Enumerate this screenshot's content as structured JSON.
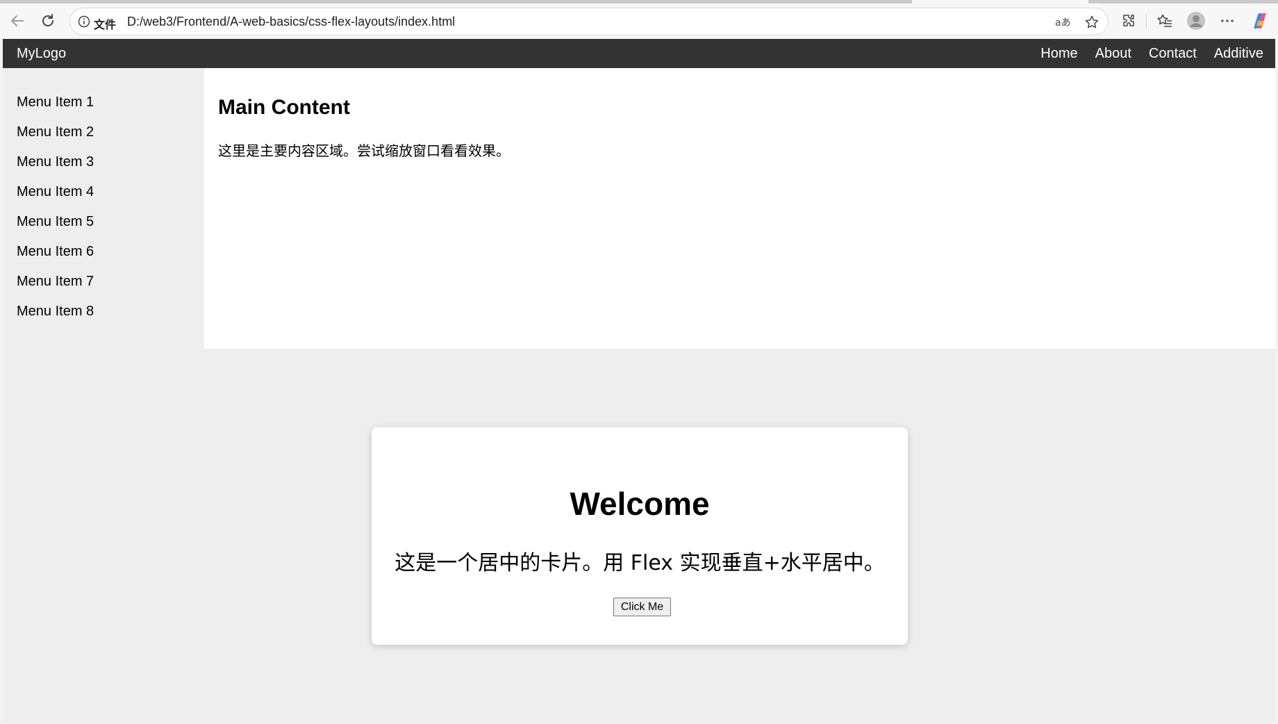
{
  "browser": {
    "address_scheme_label": "文件",
    "url": "D:/web3/Frontend/A-web-basics/css-flex-layouts/index.html"
  },
  "page": {
    "navbar": {
      "logo": "MyLogo",
      "links": [
        "Home",
        "About",
        "Contact",
        "Additive"
      ]
    },
    "sidebar": {
      "items": [
        "Menu Item 1",
        "Menu Item 2",
        "Menu Item 3",
        "Menu Item 4",
        "Menu Item 5",
        "Menu Item 6",
        "Menu Item 7",
        "Menu Item 8"
      ]
    },
    "main": {
      "title": "Main Content",
      "text": "这里是主要内容区域。尝试缩放窗口看看效果。"
    },
    "card": {
      "title": "Welcome",
      "text": "这是一个居中的卡片。用 Flex 实现垂直+水平居中。",
      "button_label": "Click Me"
    }
  }
}
